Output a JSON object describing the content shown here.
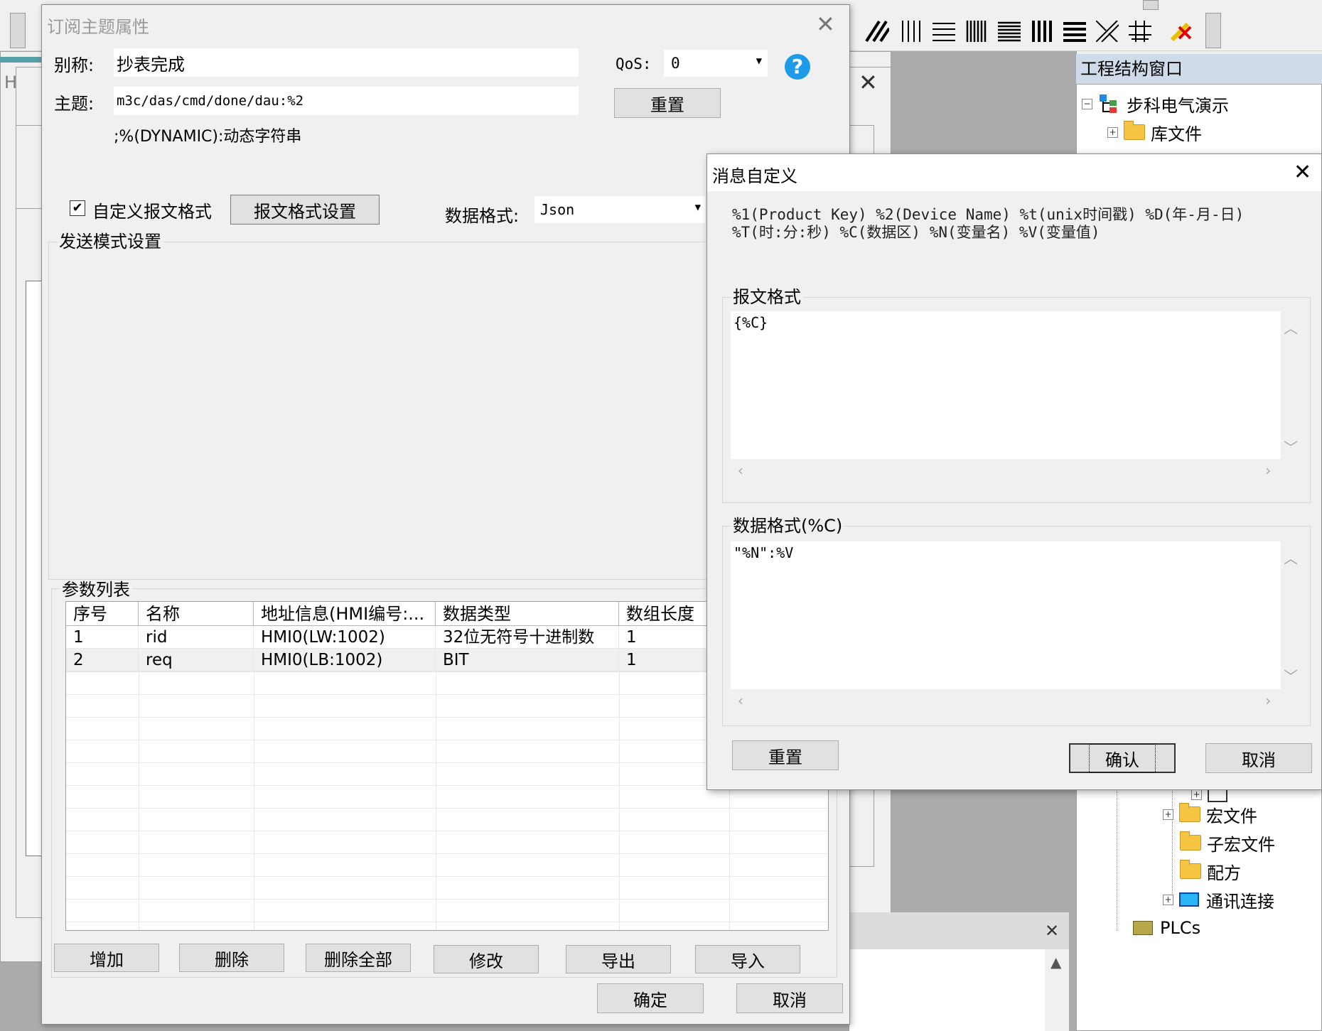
{
  "back": {
    "hmi_tab": "HMI",
    "toolbar_icons": [
      "hatch-diagonal-icon",
      "vertical-lines-icon",
      "horizontal-lines-icon",
      "dense-vertical-icon",
      "dense-horizontal-icon",
      "bold-vertical-icon",
      "bold-horizontal-icon",
      "cross-hatch-icon",
      "grid-pattern-icon",
      "erase-icon"
    ]
  },
  "project_tree": {
    "title": "工程结构窗口",
    "items_top": [
      {
        "label": "步科电气演示",
        "expander": "⊟"
      },
      {
        "label": "库文件",
        "expander": "⊞"
      }
    ],
    "items_bottom": [
      {
        "label": "宏文件",
        "expander": "⊞"
      },
      {
        "label": "子宏文件",
        "expander": ""
      },
      {
        "label": "配方",
        "expander": ""
      },
      {
        "label": "通讯连接",
        "expander": "⊞"
      },
      {
        "label": "PLCs",
        "expander": ""
      }
    ]
  },
  "subscribe_dialog": {
    "title": "订阅主题属性",
    "alias_label": "别称:",
    "alias_value": "抄表完成",
    "topic_label": "主题:",
    "topic_value": "m3c/das/cmd/done/dau:%2",
    "dynamic_hint": ";%(DYNAMIC):动态字符串",
    "qos_label": "QoS:",
    "qos_value": "0",
    "reset_label": "重置",
    "custom_format_checkbox": "自定义报文格式",
    "custom_format_checked": true,
    "format_settings_button": "报文格式设置",
    "data_format_label": "数据格式:",
    "data_format_value": "Json",
    "send_mode_group": "发送模式设置",
    "params_group": "参数列表",
    "columns": [
      "序号",
      "名称",
      "地址信息(HMI编号:...",
      "数据类型",
      "数组长度"
    ],
    "rows": [
      {
        "index": "1",
        "name": "rid",
        "address": "HMI0(LW:1002)",
        "type": "32位无符号十进制数",
        "length": "1"
      },
      {
        "index": "2",
        "name": "req",
        "address": "HMI0(LB:1002)",
        "type": "BIT",
        "length": "1"
      }
    ],
    "buttons": {
      "add": "增加",
      "delete": "删除",
      "delete_all": "删除全部",
      "modify": "修改",
      "export": "导出",
      "import": "导入",
      "ok": "确定",
      "cancel": "取消"
    }
  },
  "message_dialog": {
    "title": "消息自定义",
    "description": "%1(Product Key) %2(Device Name) %t(unix时间戳) %D(年-月-日) %T(时:分:秒) %C(数据区) %N(变量名) %V(变量值)",
    "message_format_group": "报文格式",
    "message_format_value": "{%C}",
    "data_format_group": "数据格式(%C)",
    "data_format_value": "\"%N\":%V",
    "reset_button": "重置",
    "confirm_button": "确认",
    "cancel_button": "取消"
  }
}
